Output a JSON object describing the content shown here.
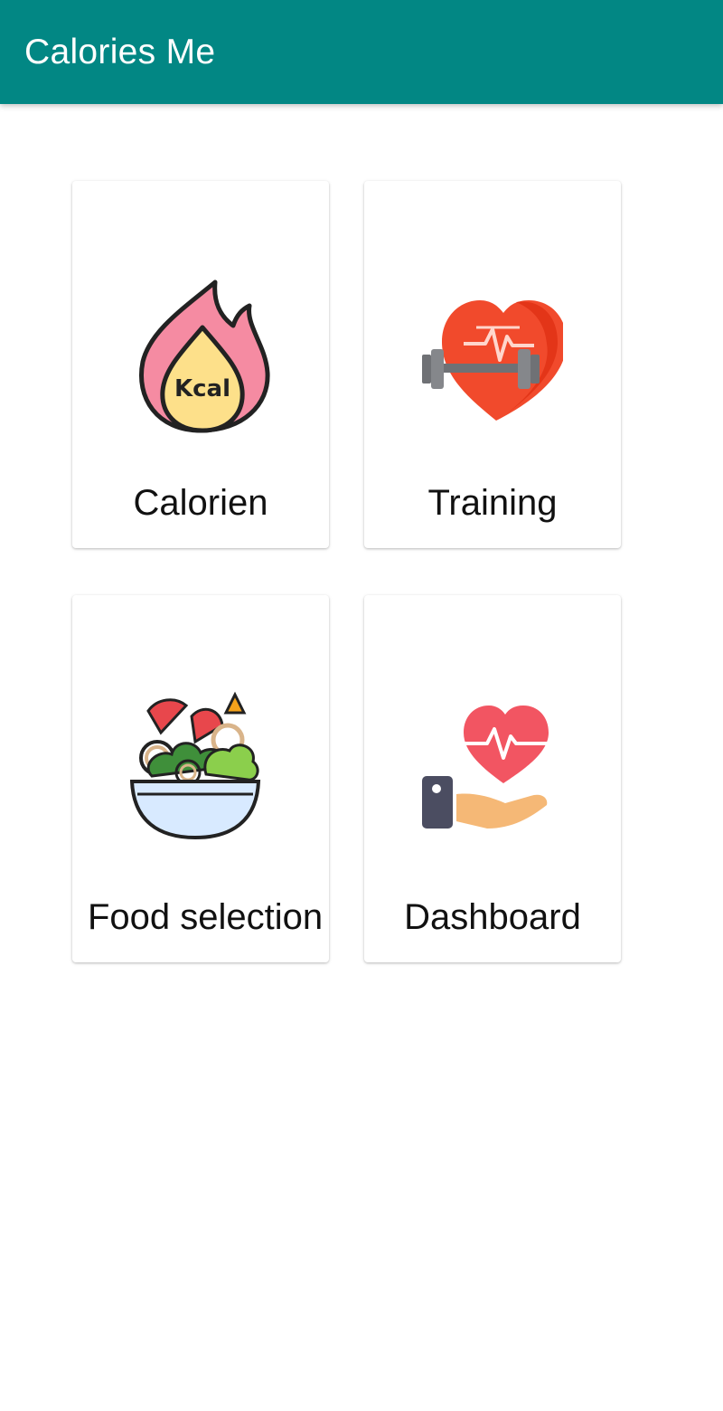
{
  "appbar": {
    "title": "Calories Me",
    "color": "#028784"
  },
  "menu": {
    "items": [
      {
        "label": "Calorien",
        "icon": "kcal-flame-icon",
        "icon_text": "Kcal"
      },
      {
        "label": "Training",
        "icon": "heart-dumbbell-icon"
      },
      {
        "label": "Food selection",
        "icon": "salad-bowl-icon"
      },
      {
        "label": "Dashboard",
        "icon": "heart-hand-icon"
      }
    ]
  }
}
